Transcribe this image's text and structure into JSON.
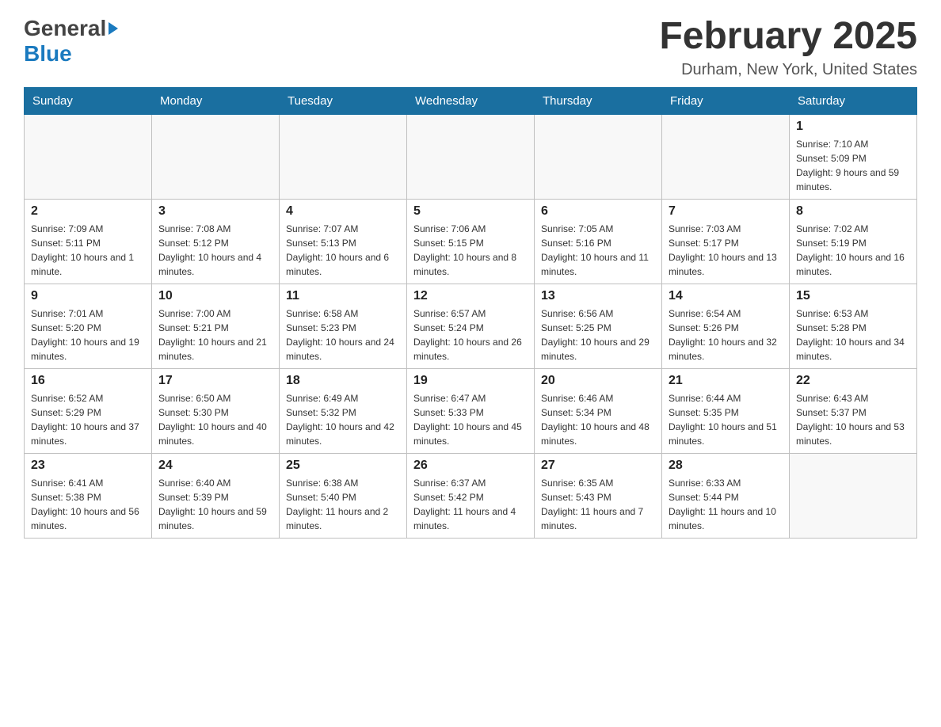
{
  "header": {
    "logo_general": "General",
    "logo_blue": "Blue",
    "title": "February 2025",
    "location": "Durham, New York, United States"
  },
  "days_of_week": [
    "Sunday",
    "Monday",
    "Tuesday",
    "Wednesday",
    "Thursday",
    "Friday",
    "Saturday"
  ],
  "weeks": [
    [
      {
        "day": "",
        "info": ""
      },
      {
        "day": "",
        "info": ""
      },
      {
        "day": "",
        "info": ""
      },
      {
        "day": "",
        "info": ""
      },
      {
        "day": "",
        "info": ""
      },
      {
        "day": "",
        "info": ""
      },
      {
        "day": "1",
        "info": "Sunrise: 7:10 AM\nSunset: 5:09 PM\nDaylight: 9 hours and 59 minutes."
      }
    ],
    [
      {
        "day": "2",
        "info": "Sunrise: 7:09 AM\nSunset: 5:11 PM\nDaylight: 10 hours and 1 minute."
      },
      {
        "day": "3",
        "info": "Sunrise: 7:08 AM\nSunset: 5:12 PM\nDaylight: 10 hours and 4 minutes."
      },
      {
        "day": "4",
        "info": "Sunrise: 7:07 AM\nSunset: 5:13 PM\nDaylight: 10 hours and 6 minutes."
      },
      {
        "day": "5",
        "info": "Sunrise: 7:06 AM\nSunset: 5:15 PM\nDaylight: 10 hours and 8 minutes."
      },
      {
        "day": "6",
        "info": "Sunrise: 7:05 AM\nSunset: 5:16 PM\nDaylight: 10 hours and 11 minutes."
      },
      {
        "day": "7",
        "info": "Sunrise: 7:03 AM\nSunset: 5:17 PM\nDaylight: 10 hours and 13 minutes."
      },
      {
        "day": "8",
        "info": "Sunrise: 7:02 AM\nSunset: 5:19 PM\nDaylight: 10 hours and 16 minutes."
      }
    ],
    [
      {
        "day": "9",
        "info": "Sunrise: 7:01 AM\nSunset: 5:20 PM\nDaylight: 10 hours and 19 minutes."
      },
      {
        "day": "10",
        "info": "Sunrise: 7:00 AM\nSunset: 5:21 PM\nDaylight: 10 hours and 21 minutes."
      },
      {
        "day": "11",
        "info": "Sunrise: 6:58 AM\nSunset: 5:23 PM\nDaylight: 10 hours and 24 minutes."
      },
      {
        "day": "12",
        "info": "Sunrise: 6:57 AM\nSunset: 5:24 PM\nDaylight: 10 hours and 26 minutes."
      },
      {
        "day": "13",
        "info": "Sunrise: 6:56 AM\nSunset: 5:25 PM\nDaylight: 10 hours and 29 minutes."
      },
      {
        "day": "14",
        "info": "Sunrise: 6:54 AM\nSunset: 5:26 PM\nDaylight: 10 hours and 32 minutes."
      },
      {
        "day": "15",
        "info": "Sunrise: 6:53 AM\nSunset: 5:28 PM\nDaylight: 10 hours and 34 minutes."
      }
    ],
    [
      {
        "day": "16",
        "info": "Sunrise: 6:52 AM\nSunset: 5:29 PM\nDaylight: 10 hours and 37 minutes."
      },
      {
        "day": "17",
        "info": "Sunrise: 6:50 AM\nSunset: 5:30 PM\nDaylight: 10 hours and 40 minutes."
      },
      {
        "day": "18",
        "info": "Sunrise: 6:49 AM\nSunset: 5:32 PM\nDaylight: 10 hours and 42 minutes."
      },
      {
        "day": "19",
        "info": "Sunrise: 6:47 AM\nSunset: 5:33 PM\nDaylight: 10 hours and 45 minutes."
      },
      {
        "day": "20",
        "info": "Sunrise: 6:46 AM\nSunset: 5:34 PM\nDaylight: 10 hours and 48 minutes."
      },
      {
        "day": "21",
        "info": "Sunrise: 6:44 AM\nSunset: 5:35 PM\nDaylight: 10 hours and 51 minutes."
      },
      {
        "day": "22",
        "info": "Sunrise: 6:43 AM\nSunset: 5:37 PM\nDaylight: 10 hours and 53 minutes."
      }
    ],
    [
      {
        "day": "23",
        "info": "Sunrise: 6:41 AM\nSunset: 5:38 PM\nDaylight: 10 hours and 56 minutes."
      },
      {
        "day": "24",
        "info": "Sunrise: 6:40 AM\nSunset: 5:39 PM\nDaylight: 10 hours and 59 minutes."
      },
      {
        "day": "25",
        "info": "Sunrise: 6:38 AM\nSunset: 5:40 PM\nDaylight: 11 hours and 2 minutes."
      },
      {
        "day": "26",
        "info": "Sunrise: 6:37 AM\nSunset: 5:42 PM\nDaylight: 11 hours and 4 minutes."
      },
      {
        "day": "27",
        "info": "Sunrise: 6:35 AM\nSunset: 5:43 PM\nDaylight: 11 hours and 7 minutes."
      },
      {
        "day": "28",
        "info": "Sunrise: 6:33 AM\nSunset: 5:44 PM\nDaylight: 11 hours and 10 minutes."
      },
      {
        "day": "",
        "info": ""
      }
    ]
  ]
}
